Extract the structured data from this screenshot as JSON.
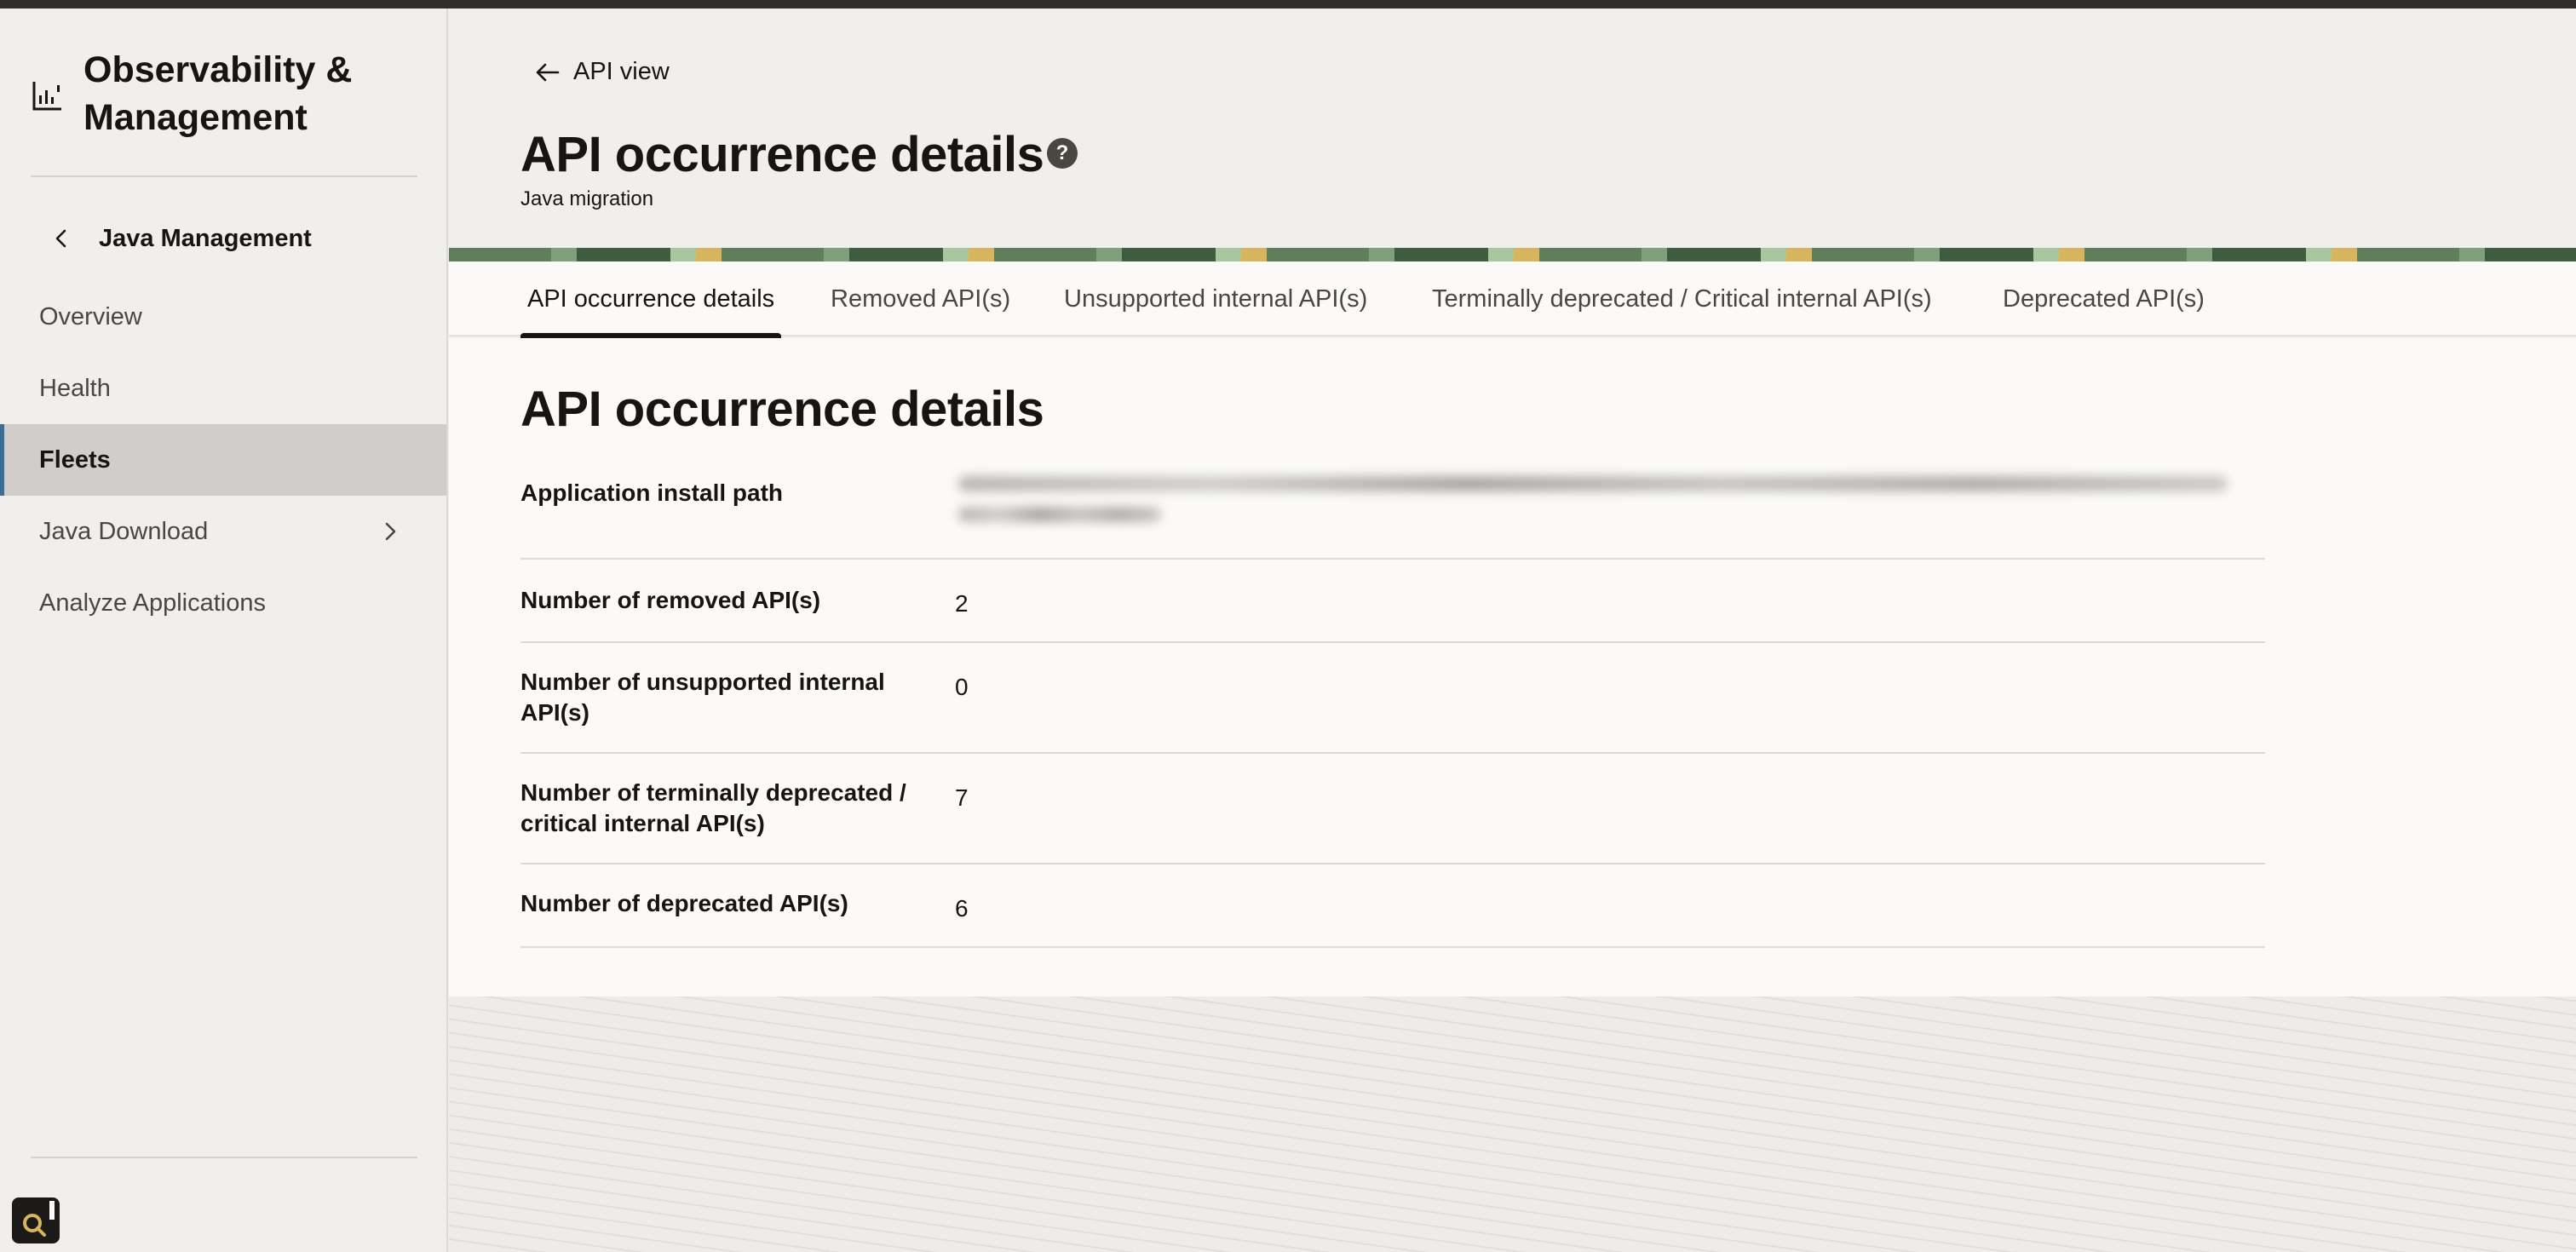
{
  "sidebar": {
    "brand_title": "Observability & Management",
    "back_label": "Java Management",
    "items": [
      {
        "label": "Overview"
      },
      {
        "label": "Health"
      },
      {
        "label": "Fleets"
      },
      {
        "label": "Java Download"
      },
      {
        "label": "Analyze Applications"
      }
    ],
    "active_item": "Fleets"
  },
  "header": {
    "back_link": "API view",
    "title": "API occurrence details",
    "subtitle": "Java migration"
  },
  "tabs": [
    {
      "label": "API occurrence details"
    },
    {
      "label": "Removed API(s)"
    },
    {
      "label": "Unsupported internal API(s)"
    },
    {
      "label": "Terminally deprecated / Critical internal API(s)"
    },
    {
      "label": "Deprecated API(s)"
    }
  ],
  "active_tab": "API occurrence details",
  "details": {
    "section_title": "API occurrence details",
    "rows": [
      {
        "label": "Application install path",
        "value": ""
      },
      {
        "label": "Number of removed API(s)",
        "value": "2"
      },
      {
        "label": "Number of unsupported internal API(s)",
        "value": "0"
      },
      {
        "label": "Number of terminally deprecated / critical internal API(s)",
        "value": "7"
      },
      {
        "label": "Number of deprecated API(s)",
        "value": "6"
      }
    ]
  },
  "colors": {
    "active_nav_bg": "#d0cdca",
    "active_nav_accent": "#3a6e98",
    "tab_indicator": "#161513"
  }
}
